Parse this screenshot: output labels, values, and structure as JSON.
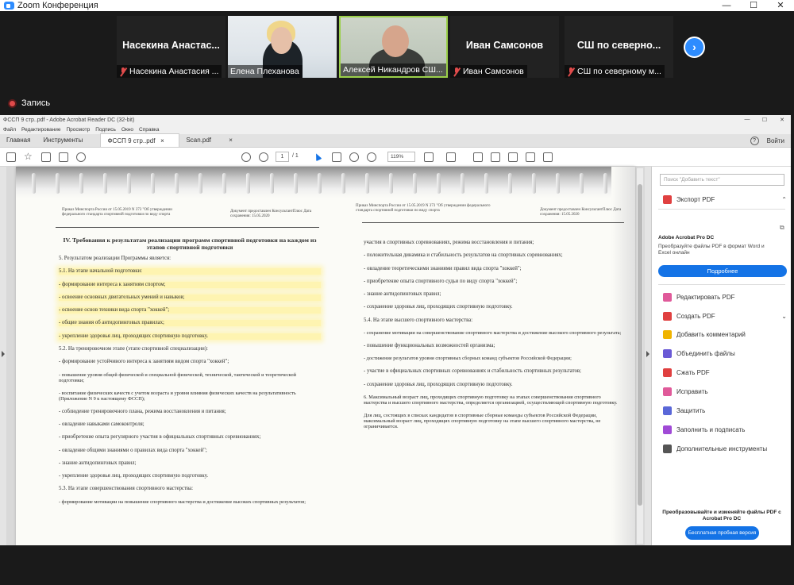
{
  "zoom": {
    "window_title": "Zoom Конференция",
    "minimize": "—",
    "maximize": "☐",
    "close": "✕",
    "recording_label": "Запись",
    "next_arrow": "›",
    "participants": [
      {
        "big_name": "Насекина  Анастас...",
        "label": "Насекина Анастасия ..."
      },
      {
        "label": "Елена Плеханова"
      },
      {
        "label": "Алексей Никандров СШ..."
      },
      {
        "big_name": "Иван Самсонов",
        "label": "Иван Самсонов"
      },
      {
        "big_name": "СШ по северно...",
        "label": "СШ по северному м..."
      }
    ]
  },
  "acrobat": {
    "title": "ФССП 9 стр..pdf - Adobe Acrobat Reader DC (32-bit)",
    "win_min": "—",
    "win_max": "☐",
    "win_close": "✕",
    "menu": [
      "Файл",
      "Редактирование",
      "Просмотр",
      "Подпись",
      "Окно",
      "Справка"
    ],
    "tabs": {
      "home": "Главная",
      "tools": "Инструменты",
      "doc1": "ФССП 9 стр..pdf",
      "doc1_close": "×",
      "doc2": "Scan.pdf",
      "doc2_close": "×",
      "help": "?",
      "signin": "Войти"
    },
    "toolbar": {
      "page_current": "1",
      "page_total": "/ 1",
      "zoom": "119%"
    },
    "right_panel": {
      "search_placeholder": "Поиск \"Добавить текст\"",
      "export_pdf": "Экспорт PDF",
      "promo_title": "Adobe Acrobat Pro DC",
      "promo_text": "Преобразуйте файлы PDF в формат Word и Excel онлайн",
      "promo_button": "Подробнее",
      "tools": [
        {
          "label": "Редактировать PDF",
          "color": "#e05a9a"
        },
        {
          "label": "Создать PDF",
          "color": "#e04040"
        },
        {
          "label": "Добавить комментарий",
          "color": "#f0b400"
        },
        {
          "label": "Объединить файлы",
          "color": "#6a5ad6"
        },
        {
          "label": "Сжать PDF",
          "color": "#e04040"
        },
        {
          "label": "Исправить",
          "color": "#e05a9a"
        },
        {
          "label": "Защитить",
          "color": "#5a67d8"
        },
        {
          "label": "Заполнить и подписать",
          "color": "#a04ad6"
        },
        {
          "label": "Дополнительные инструменты",
          "color": "#555555"
        }
      ],
      "bottom_text": "Преобразовывайте и изменяйте файлы PDF с Acrobat Pro DC",
      "bottom_button": "Бесплатная пробная версия"
    }
  },
  "document": {
    "left_header_left": "Приказ Минспорта России от 15.05.2019 N 373 \"Об утверждении федерального стандарта спортивной подготовки по виду спорта",
    "left_header_right": "Документ предоставлен КонсультантПлюс Дата сохранения: 15.05.2020",
    "heading": "IV. Требования к результатам реализации программ спортивной подготовки на каждом из этапов спортивной подготовки",
    "left_lines": [
      "5. Результатом реализации Программы является:",
      "5.1. На этапе начальной подготовки:",
      "- формирование интереса к занятиям спортом;",
      "- освоение основных двигательных умений и навыков;",
      "- освоение основ техники вида спорта \"хоккей\";",
      "- общие знания об антидопинговых правилах;",
      "- укрепление здоровья лиц, проходящих спортивную подготовку.",
      "5.2. На тренировочном этапе (этапе спортивной специализации):",
      "- формирование устойчивого интереса к занятиям видом спорта \"хоккей\";",
      "- повышение уровня общей физической и специальной физической, технической, тактической и теоретической подготовки;",
      "- воспитание физических качеств с учетом возраста и уровня влияния физических качеств на результативность (Приложение N 9 к настоящему ФССП);",
      "- соблюдение тренировочного плана, режима восстановления и питания;",
      "- овладение навыками самоконтроля;",
      "- приобретение опыта регулярного участия в официальных спортивных соревнованиях;",
      "- овладение общими знаниями о правилах вида спорта \"хоккей\";",
      "- знание антидопинговых правил;",
      "- укрепление здоровья лиц, проходящих спортивную подготовку.",
      "5.3. На этапе совершенствования спортивного мастерства:",
      "- формирование мотивации на повышение спортивного мастерства и достижение высоких спортивных результатов;"
    ],
    "right_header_left": "Приказ Минспорта России от 15.05.2019 N 373 \"Об утверждении федерального стандарта спортивной подготовки по виду спорта",
    "right_header_right": "Документ предоставлен КонсультантПлюс Дата сохранения: 15.05.2020",
    "right_lines": [
      "участия в спортивных соревнованиях, режима восстановления и питания;",
      "- положительная динамика и стабильность результатов на спортивных соревнованиях;",
      "- овладение теоретическими знаниями правил вида спорта \"хоккей\";",
      "- приобретение опыта спортивного судьи по виду спорта \"хоккей\";",
      "- знание антидопинговых правил;",
      "- сохранение здоровья лиц, проходящих спортивную подготовку.",
      "5.4. На этапе высшего спортивного мастерства:",
      "- сохранение мотивации на совершенствование спортивного мастерства и достижение высокого спортивного результата;",
      "- повышение функциональных возможностей организма;",
      "- достижение результатов уровня спортивных сборных команд субъектов Российской Федерации;",
      "- участие в официальных спортивных соревнованиях и стабильность спортивных результатов;",
      "- сохранение здоровья лиц, проходящих спортивную подготовку.",
      "6. Максимальный возраст лиц, проходящих спортивную подготовку на этапах совершенствования спортивного мастерства и высшего спортивного мастерства, определяется организацией, осуществляющей спортивную подготовку.",
      "Для лиц, состоящих в списках кандидатов в спортивные сборные команды субъектов Российской Федерации, максимальный возраст лиц, проходящих спортивную подготовку на этапе высшего спортивного мастерства, не ограничивается."
    ]
  }
}
